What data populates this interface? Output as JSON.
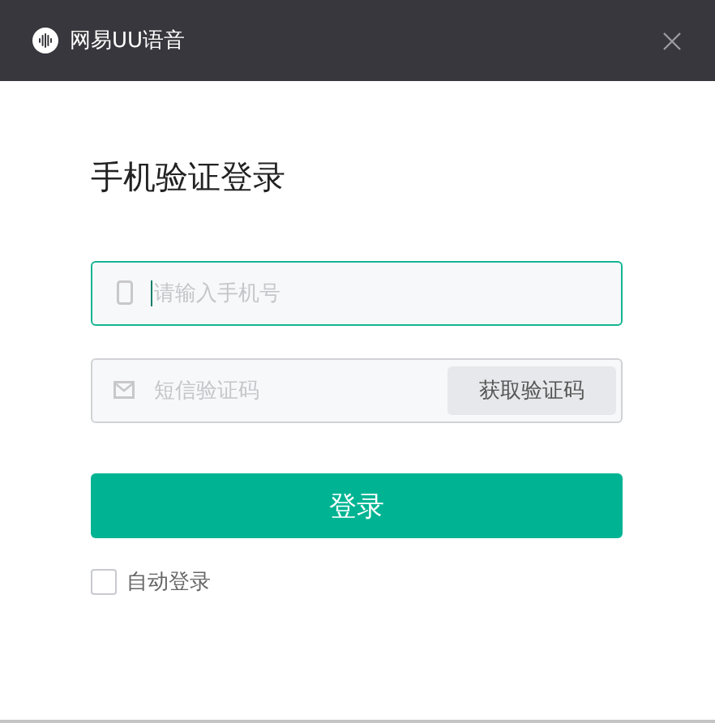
{
  "window": {
    "title": "网易UU语音"
  },
  "heading": "手机验证登录",
  "phone_field": {
    "placeholder": "请输入手机号",
    "focused": true
  },
  "code_field": {
    "placeholder": "短信验证码",
    "focused": false
  },
  "get_code_button": "获取验证码",
  "login_button": "登录",
  "auto_login": {
    "label": "自动登录",
    "checked": false
  }
}
